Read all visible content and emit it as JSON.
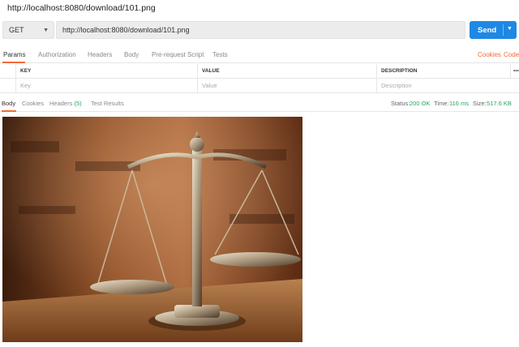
{
  "window": {
    "title": "http://localhost:8080/download/101.png"
  },
  "request": {
    "method": "GET",
    "url": "http://localhost:8080/download/101.png",
    "send_label": "Send"
  },
  "request_tabs": {
    "params": "Params",
    "authorization": "Authorization",
    "headers": "Headers",
    "body": "Body",
    "prerequest": "Pre-request Script",
    "tests": "Tests",
    "cookies_link": "Cookies",
    "code_link": "Code"
  },
  "params_table": {
    "columns": [
      "KEY",
      "VALUE",
      "DESCRIPTION"
    ],
    "more": "•••",
    "placeholders": {
      "key": "Key",
      "value": "Value",
      "description": "Description"
    }
  },
  "response_tabs": {
    "body": "Body",
    "cookies": "Cookies",
    "headers": "Headers",
    "headers_count": "(5)",
    "test_results": "Test Results"
  },
  "response_meta": {
    "status_label": "Status:",
    "status_value": "200 OK",
    "time_label": "Time:",
    "time_value": "116 ms",
    "size_label": "Size:",
    "size_value": "517.6 KB"
  },
  "colors": {
    "accent": "#f26b3a",
    "send": "#1e88e5",
    "success": "#26a65b"
  },
  "preview": {
    "subject": "scales-of-justice-image"
  }
}
